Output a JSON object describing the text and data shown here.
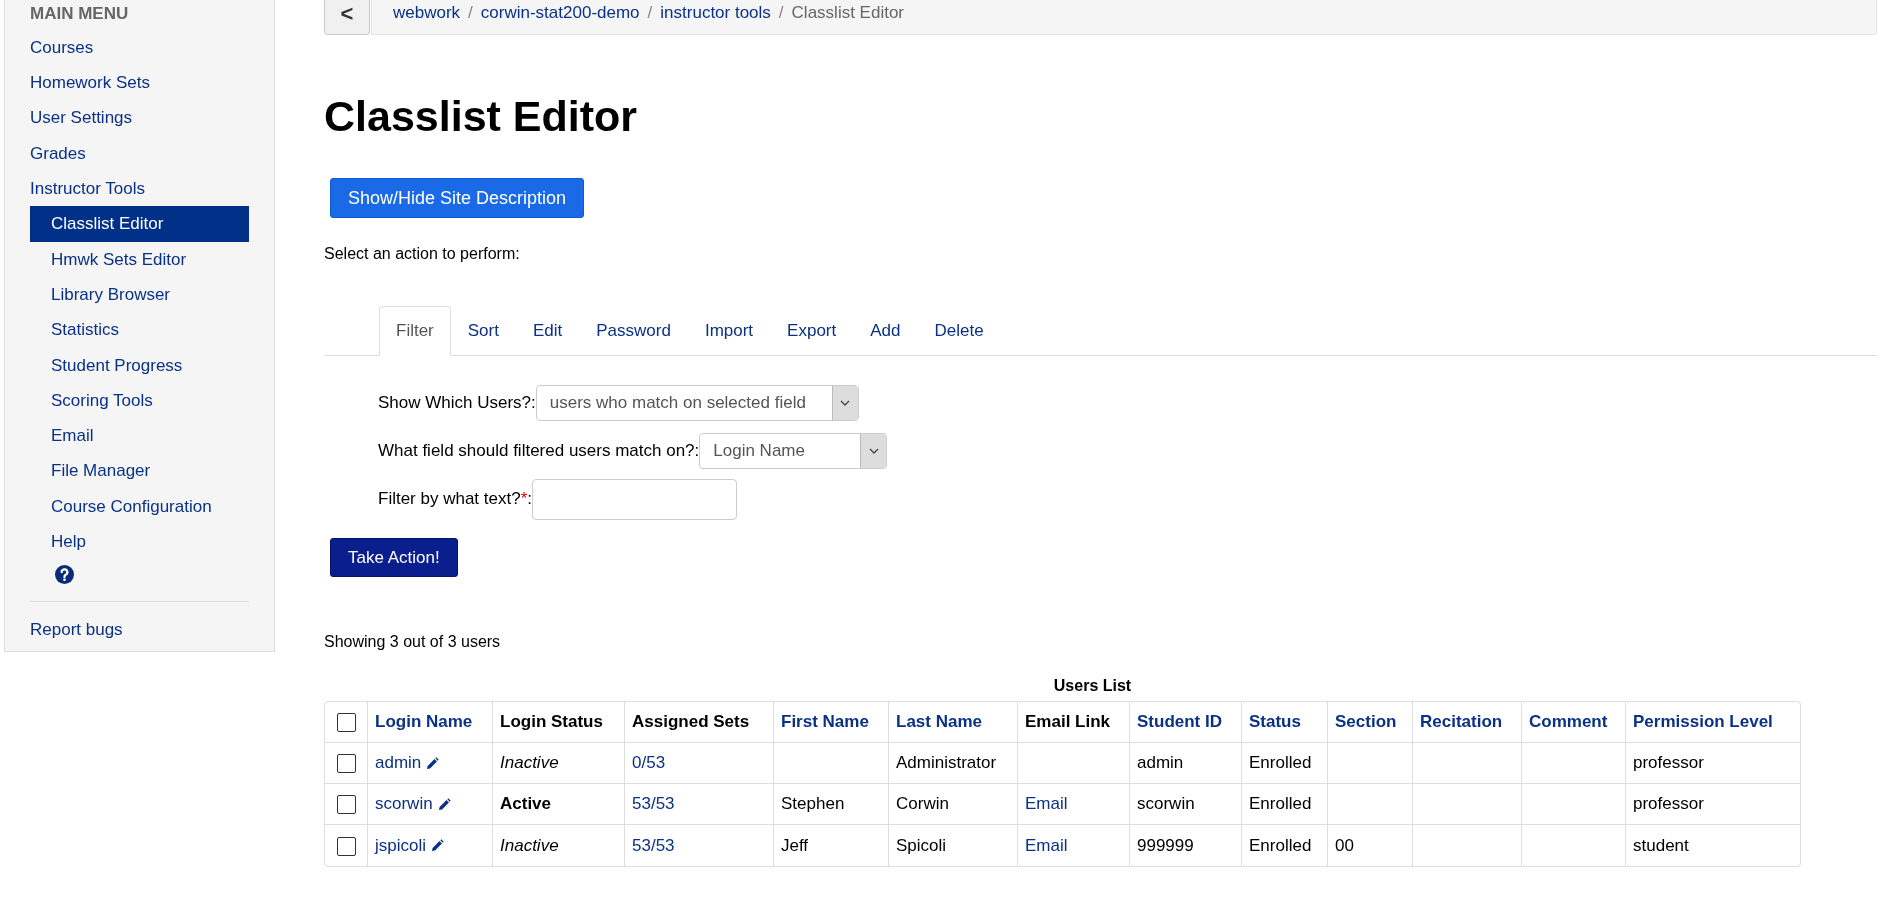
{
  "sidebar": {
    "heading": "MAIN MENU",
    "items": [
      {
        "label": "Courses",
        "selected": false
      },
      {
        "label": "Homework Sets",
        "selected": false
      },
      {
        "label": "User Settings",
        "selected": false
      },
      {
        "label": "Grades",
        "selected": false
      },
      {
        "label": "Instructor Tools",
        "selected": false,
        "children": [
          {
            "kind": "link",
            "label": "Classlist Editor",
            "selected": true
          },
          {
            "kind": "link",
            "label": "Hmwk Sets Editor",
            "selected": false
          },
          {
            "kind": "link",
            "label": "Library Browser",
            "selected": false
          },
          {
            "kind": "link",
            "label": "Statistics",
            "selected": false
          },
          {
            "kind": "link",
            "label": "Student Progress",
            "selected": false
          },
          {
            "kind": "link",
            "label": "Scoring Tools",
            "selected": false
          },
          {
            "kind": "link",
            "label": "Email",
            "selected": false
          },
          {
            "kind": "link",
            "label": "File Manager",
            "selected": false
          },
          {
            "kind": "link",
            "label": "Course Configuration",
            "selected": false
          },
          {
            "kind": "link",
            "label": "Help",
            "selected": false
          },
          {
            "kind": "icon"
          }
        ]
      }
    ],
    "footer_links": [
      "Report bugs"
    ]
  },
  "breadcrumb": {
    "back_label": "<",
    "links": [
      "webwork",
      "corwin-stat200-demo",
      "instructor tools"
    ],
    "current": "Classlist Editor",
    "separator": "/"
  },
  "title": "Classlist Editor",
  "site_button": "Show/Hide Site Description",
  "prompt": "Select an action to perform:",
  "tabs": [
    {
      "label": "Filter",
      "selected": true
    },
    {
      "label": "Sort",
      "selected": false
    },
    {
      "label": "Edit",
      "selected": false
    },
    {
      "label": "Password",
      "selected": false
    },
    {
      "label": "Import",
      "selected": false
    },
    {
      "label": "Export",
      "selected": false
    },
    {
      "label": "Add",
      "selected": false
    },
    {
      "label": "Delete",
      "selected": false
    }
  ],
  "form": [
    {
      "kind": "select",
      "label": "Show Which Users?:",
      "value": "users who match on selected field"
    },
    {
      "kind": "select",
      "label": "What field should filtered users match on?:",
      "value": "Login Name"
    },
    {
      "kind": "text",
      "label": "Filter by what text?",
      "required_mark": "*",
      "suffix": ":"
    }
  ],
  "action_button": "Take Action!",
  "summary": "Showing 3 out of 3 users",
  "table": {
    "caption": "Users List",
    "select_all_checked": false,
    "columns": [
      {
        "label": "Login Name",
        "sortable": true
      },
      {
        "label": "Login Status",
        "sortable": false
      },
      {
        "label": "Assigned Sets",
        "sortable": false
      },
      {
        "label": "First Name",
        "sortable": true
      },
      {
        "label": "Last Name",
        "sortable": true
      },
      {
        "label": "Email Link",
        "sortable": false
      },
      {
        "label": "Student ID",
        "sortable": true
      },
      {
        "label": "Status",
        "sortable": true
      },
      {
        "label": "Section",
        "sortable": true
      },
      {
        "label": "Recitation",
        "sortable": true
      },
      {
        "label": "Comment",
        "sortable": true
      },
      {
        "label": "Permission Level",
        "sortable": true
      }
    ],
    "rows": [
      {
        "checked": false,
        "cells": [
          {
            "kind": "login",
            "text": "admin"
          },
          {
            "kind": "status",
            "text": "Inactive",
            "active": false
          },
          {
            "kind": "link",
            "text": "0/53"
          },
          {
            "kind": "empty"
          },
          {
            "kind": "text",
            "text": "Administrator"
          },
          {
            "kind": "empty"
          },
          {
            "kind": "text",
            "text": "admin"
          },
          {
            "kind": "text",
            "text": "Enrolled"
          },
          {
            "kind": "empty"
          },
          {
            "kind": "empty"
          },
          {
            "kind": "empty"
          },
          {
            "kind": "text",
            "text": "professor"
          }
        ]
      },
      {
        "checked": false,
        "cells": [
          {
            "kind": "login",
            "text": "scorwin"
          },
          {
            "kind": "status",
            "text": "Active",
            "active": true
          },
          {
            "kind": "link",
            "text": "53/53"
          },
          {
            "kind": "text",
            "text": "Stephen"
          },
          {
            "kind": "text",
            "text": "Corwin"
          },
          {
            "kind": "link",
            "text": "Email"
          },
          {
            "kind": "text",
            "text": "scorwin"
          },
          {
            "kind": "text",
            "text": "Enrolled"
          },
          {
            "kind": "empty"
          },
          {
            "kind": "empty"
          },
          {
            "kind": "empty"
          },
          {
            "kind": "text",
            "text": "professor"
          }
        ]
      },
      {
        "checked": false,
        "cells": [
          {
            "kind": "login",
            "text": "jspicoli"
          },
          {
            "kind": "status",
            "text": "Inactive",
            "active": false
          },
          {
            "kind": "link",
            "text": "53/53"
          },
          {
            "kind": "text",
            "text": "Jeff"
          },
          {
            "kind": "text",
            "text": "Spicoli"
          },
          {
            "kind": "link",
            "text": "Email"
          },
          {
            "kind": "text",
            "text": "999999"
          },
          {
            "kind": "text",
            "text": "Enrolled"
          },
          {
            "kind": "text",
            "text": "00"
          },
          {
            "kind": "empty"
          },
          {
            "kind": "empty"
          },
          {
            "kind": "text",
            "text": "student"
          }
        ]
      }
    ]
  }
}
